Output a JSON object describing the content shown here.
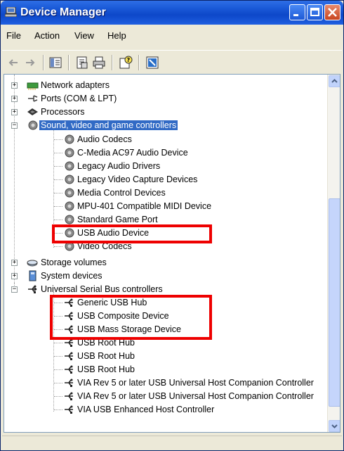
{
  "window": {
    "title": "Device Manager"
  },
  "menu": [
    "File",
    "Action",
    "View",
    "Help"
  ],
  "toolbar": {
    "icons": [
      "back-arrow-icon",
      "forward-arrow-icon",
      "show-hide-tree-icon",
      "properties-icon",
      "print-icon",
      "help-icon",
      "scan-hardware-icon"
    ]
  },
  "tree": {
    "categories_top": [
      {
        "label": "Network adapters",
        "icon": "network-icon"
      },
      {
        "label": "Ports (COM & LPT)",
        "icon": "port-icon"
      },
      {
        "label": "Processors",
        "icon": "processor-icon"
      }
    ],
    "sound": {
      "label": "Sound, video and game controllers",
      "children": [
        "Audio Codecs",
        "C-Media AC97 Audio Device",
        "Legacy Audio Drivers",
        "Legacy Video Capture Devices",
        "Media Control Devices",
        "MPU-401 Compatible MIDI Device",
        "Standard Game Port",
        "USB Audio Device",
        "Video Codecs"
      ]
    },
    "categories_mid": [
      {
        "label": "Storage volumes",
        "icon": "storage-icon"
      },
      {
        "label": "System devices",
        "icon": "system-icon"
      }
    ],
    "usb": {
      "label": "Universal Serial Bus controllers",
      "children": [
        "Generic USB Hub",
        "USB Composite Device",
        "USB Mass Storage Device",
        "USB Root Hub",
        "USB Root Hub",
        "USB Root Hub",
        "VIA Rev 5 or later USB Universal Host Companion Controller",
        "VIA Rev 5 or later USB Universal Host Companion Controller",
        "VIA USB Enhanced Host Controller"
      ]
    }
  },
  "highlight_color": "#ee0000",
  "selection_color": "#316ac5"
}
